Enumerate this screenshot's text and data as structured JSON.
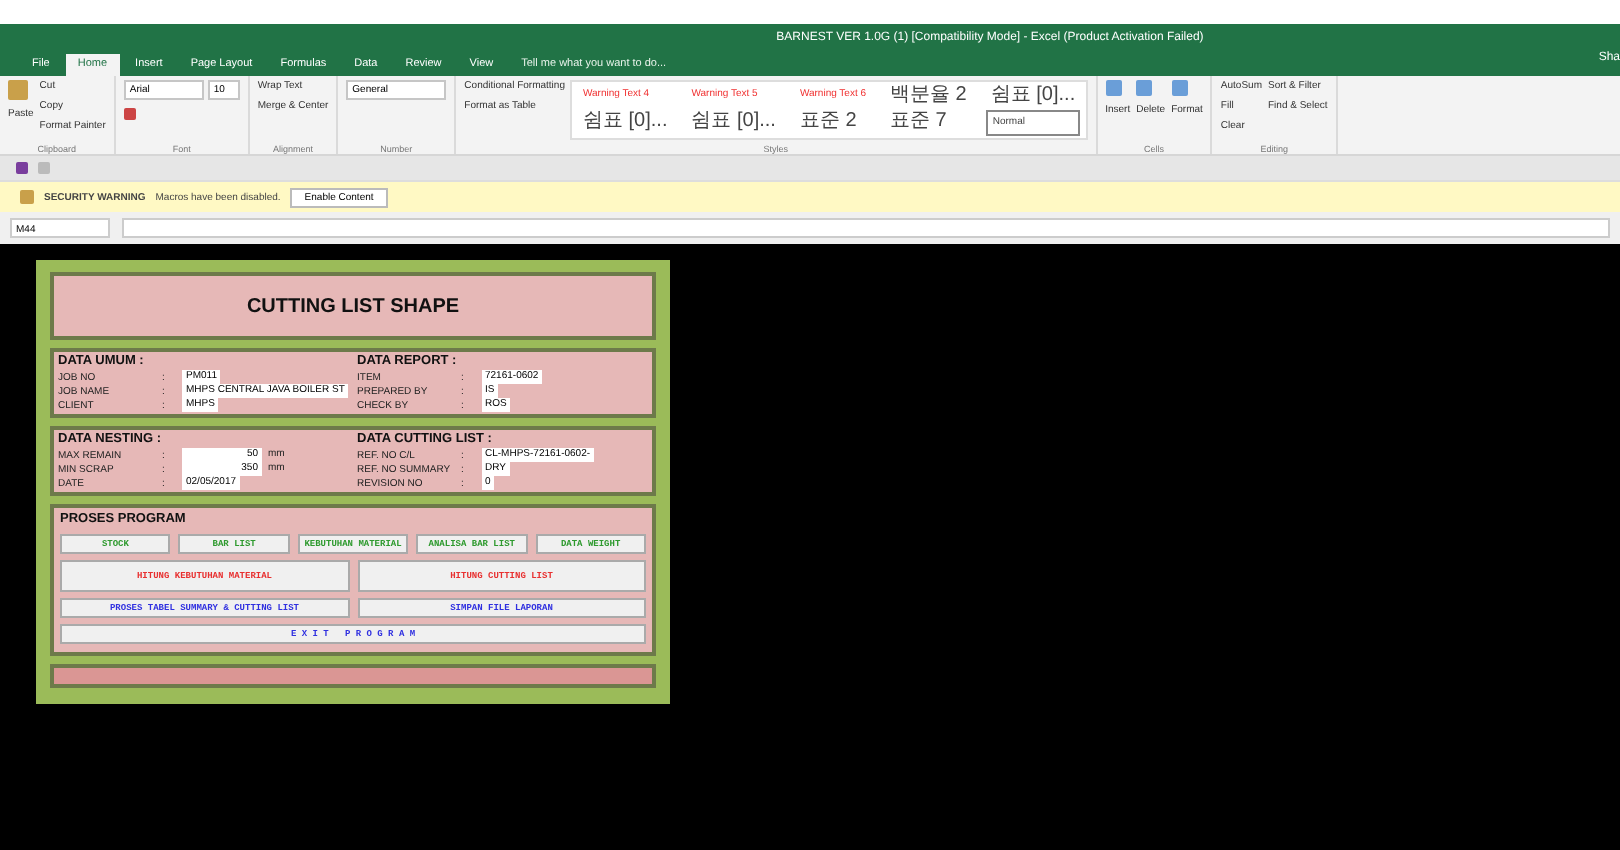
{
  "window": {
    "title": "BARNEST VER 1.0G (1) [Compatibility Mode] - Excel (Product Activation Failed)",
    "share": "Sha"
  },
  "tabs": [
    {
      "label": "File",
      "selected": false
    },
    {
      "label": "Home",
      "selected": true
    },
    {
      "label": "Insert",
      "selected": false
    },
    {
      "label": "Page Layout",
      "selected": false
    },
    {
      "label": "Formulas",
      "selected": false
    },
    {
      "label": "Data",
      "selected": false
    },
    {
      "label": "Review",
      "selected": false
    },
    {
      "label": "View",
      "selected": false
    }
  ],
  "tell_me": {
    "placeholder": "Tell me what you want to do..."
  },
  "ribbon": {
    "clipboard": {
      "paste": "Paste",
      "cut": "Cut",
      "copy": "Copy",
      "painter": "Format Painter",
      "label": "Clipboard"
    },
    "font": {
      "name": "Arial",
      "size": "10",
      "label": "Font"
    },
    "alignment": {
      "wrap": "Wrap Text",
      "merge": "Merge & Center",
      "label": "Alignment"
    },
    "number": {
      "format": "General",
      "label": "Number"
    },
    "styles": {
      "conditional": "Conditional Formatting",
      "table": "Format as Table",
      "label": "Styles",
      "items": [
        {
          "text": "Warning Text 4",
          "kind": "warning"
        },
        {
          "text": "Warning Text 5",
          "kind": "warning"
        },
        {
          "text": "Warning Text 6",
          "kind": "warning"
        },
        {
          "text": "백분율 2",
          "kind": "plain"
        },
        {
          "text": "쉼표 [0]...",
          "kind": "plain"
        },
        {
          "text": "쉼표 [0]...",
          "kind": "plain"
        },
        {
          "text": "쉼표 [0]...",
          "kind": "plain"
        },
        {
          "text": "표준 2",
          "kind": "plain"
        },
        {
          "text": "표준 7",
          "kind": "plain"
        },
        {
          "text": "Normal",
          "kind": "boxed"
        }
      ]
    },
    "cells": {
      "items": [
        "Insert",
        "Delete",
        "Format"
      ],
      "label": "Cells"
    },
    "editing": {
      "autosum": "AutoSum",
      "fill": "Fill",
      "clear": "Clear",
      "sort": "Sort & Filter",
      "find": "Find & Select",
      "label": "Editing"
    }
  },
  "security": {
    "title": "SECURITY WARNING",
    "message": "Macros have been disabled.",
    "button": "Enable Content"
  },
  "formula_bar": {
    "name_box": "M44"
  },
  "sheet": {
    "title": "CUTTING LIST SHAPE",
    "sections": [
      {
        "left": {
          "heading": "DATA UMUM :",
          "rows": [
            {
              "label": "JOB NO",
              "colon": ":",
              "value": "PM011"
            },
            {
              "label": "JOB NAME",
              "colon": ":",
              "value": "MHPS CENTRAL JAVA BOILER ST"
            },
            {
              "label": "CLIENT",
              "colon": ":",
              "value": "MHPS"
            }
          ]
        },
        "right": {
          "heading": "DATA REPORT :",
          "rows": [
            {
              "label": "ITEM",
              "colon": ":",
              "value": "72161-0602"
            },
            {
              "label": "PREPARED BY",
              "colon": ":",
              "value": "IS"
            },
            {
              "label": "CHECK BY",
              "colon": ":",
              "value": "ROS"
            }
          ]
        }
      },
      {
        "left": {
          "heading": "DATA NESTING :",
          "rows": [
            {
              "label": "MAX REMAIN",
              "colon": ":",
              "value": "50",
              "unit": "mm"
            },
            {
              "label": "MIN SCRAP",
              "colon": ":",
              "value": "350",
              "unit": "mm"
            },
            {
              "label": "DATE",
              "colon": ":",
              "value": "02/05/2017"
            }
          ]
        },
        "right": {
          "heading": "DATA CUTTING LIST :",
          "rows": [
            {
              "label": "REF. NO C/L",
              "colon": ":",
              "value": "CL-MHPS-72161-0602-"
            },
            {
              "label": "REF. NO SUMMARY",
              "colon": ":",
              "value": "DRY"
            },
            {
              "label": "REVISION NO",
              "colon": ":",
              "value": "0"
            }
          ]
        }
      }
    ],
    "program": {
      "heading": "PROSES PROGRAM",
      "button_groups": [
        {
          "buttons": [
            {
              "label": "STOCK",
              "color": "#2e9a2e"
            },
            {
              "label": "BAR LIST",
              "color": "#2e9a2e"
            },
            {
              "label": "KEBUTUHAN MATERIAL",
              "color": "#2e9a2e"
            },
            {
              "label": "ANALISA BAR LIST",
              "color": "#2e9a2e"
            },
            {
              "label": "DATA WEIGHT",
              "color": "#2e9a2e"
            }
          ]
        },
        {
          "buttons": [
            {
              "label": "HITUNG KEBUTUHAN MATERIAL",
              "color": "#e83030"
            },
            {
              "label": "HITUNG CUTTING LIST",
              "color": "#e83030"
            }
          ]
        },
        {
          "buttons": [
            {
              "label": "PROSES TABEL SUMMARY & CUTTING LIST",
              "color": "#3030e0"
            },
            {
              "label": "SIMPAN FILE LAPORAN",
              "color": "#3030e0"
            }
          ]
        },
        {
          "buttons": [
            {
              "label": "E X I T   P R O G R A M",
              "color": "#3030e0"
            }
          ]
        }
      ]
    }
  }
}
